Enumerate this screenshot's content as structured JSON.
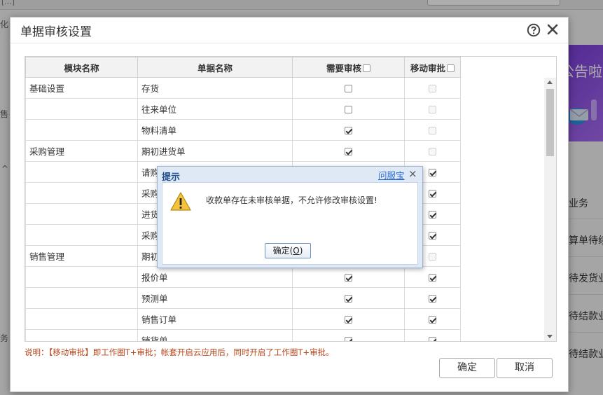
{
  "background": {
    "top_fragment": "[...]",
    "left_fragments": [
      "化",
      "售",
      "^",
      "务"
    ],
    "banner_text": "公告啦",
    "right_items": [
      "业务",
      "算单待续",
      "待发货业",
      "待结款业",
      "待结款业"
    ]
  },
  "dialog": {
    "title": "单据审核设置",
    "help_icon": "help-circle-icon",
    "close_icon": "close-icon",
    "columns": {
      "module": "模块名称",
      "document": "单据名称",
      "need_review": "需要审核",
      "mobile_approval": "移动审批"
    },
    "rows": [
      {
        "module": "基础设置",
        "document": "存货",
        "need_review": false,
        "mobile_approval": false,
        "mobile_disabled": true
      },
      {
        "module": "",
        "document": "往来单位",
        "need_review": false,
        "mobile_approval": false,
        "mobile_disabled": true
      },
      {
        "module": "",
        "document": "物料清单",
        "need_review": true,
        "mobile_approval": false,
        "mobile_disabled": true
      },
      {
        "module": "采购管理",
        "document": "期初进货单",
        "need_review": true,
        "mobile_approval": false,
        "mobile_disabled": true
      },
      {
        "module": "",
        "document": "请购",
        "need_review": true,
        "mobile_approval": true,
        "mobile_disabled": false
      },
      {
        "module": "",
        "document": "采购",
        "need_review": true,
        "mobile_approval": true,
        "mobile_disabled": false
      },
      {
        "module": "",
        "document": "进货",
        "need_review": true,
        "mobile_approval": true,
        "mobile_disabled": false
      },
      {
        "module": "",
        "document": "采购",
        "need_review": true,
        "mobile_approval": true,
        "mobile_disabled": false
      },
      {
        "module": "销售管理",
        "document": "期初",
        "need_review": true,
        "mobile_approval": false,
        "mobile_disabled": true
      },
      {
        "module": "",
        "document": "报价单",
        "need_review": true,
        "mobile_approval": true,
        "mobile_disabled": false
      },
      {
        "module": "",
        "document": "预测单",
        "need_review": true,
        "mobile_approval": true,
        "mobile_disabled": false
      },
      {
        "module": "",
        "document": "销售订单",
        "need_review": true,
        "mobile_approval": true,
        "mobile_disabled": false
      },
      {
        "module": "",
        "document": "销货单",
        "need_review": true,
        "mobile_approval": true,
        "mobile_disabled": false
      }
    ],
    "note": "说明：【移动审批】即工作圈T+审批；帐套开启云应用后，同时开启了工作圈T+审批。",
    "ok_label": "确定",
    "cancel_label": "取消"
  },
  "alert": {
    "title": "提示",
    "link": "问服宝",
    "close": "×",
    "icon": "warning-icon",
    "message": "收款单存在未审核单据，不允许修改审核设置!",
    "ok_label": "确定(",
    "ok_key": "O",
    "ok_label_end": ")"
  },
  "colors": {
    "note_text": "#b5451b",
    "alert_title": "#1f4e8c",
    "alert_link": "#2b6cd4",
    "banner": "#7b3fd9"
  }
}
